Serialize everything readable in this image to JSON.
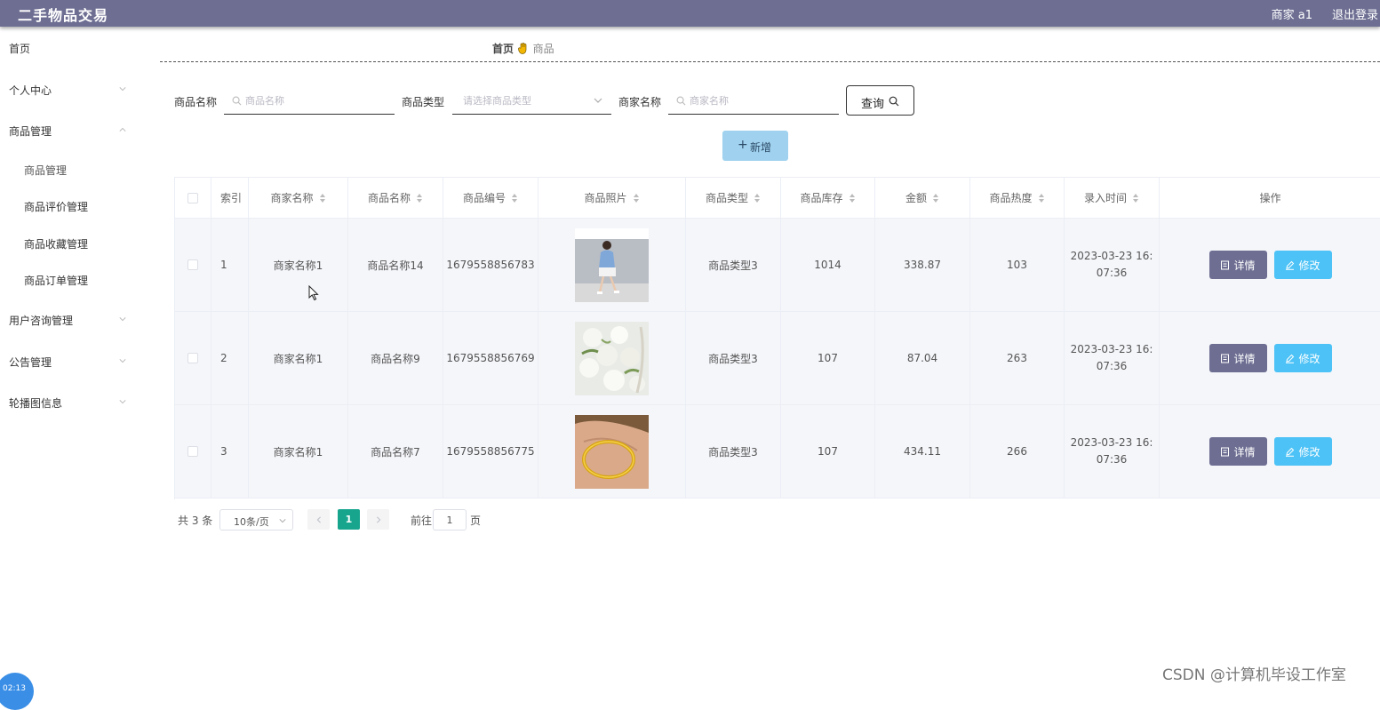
{
  "app": {
    "title": "二手物品交易",
    "user": "商家 a1",
    "logout": "退出登录"
  },
  "sidebar": {
    "home": "首页",
    "personal": "个人中心",
    "goods_group": "商品管理",
    "goods_sub": [
      "商品管理",
      "商品评价管理",
      "商品收藏管理",
      "商品订单管理"
    ],
    "consult": "用户咨询管理",
    "notice": "公告管理",
    "carousel": "轮播图信息"
  },
  "breadcrumb": {
    "home": "首页",
    "current": "商品"
  },
  "search": {
    "name_label": "商品名称",
    "name_placeholder": "商品名称",
    "type_label": "商品类型",
    "type_placeholder": "请选择商品类型",
    "merchant_label": "商家名称",
    "merchant_placeholder": "商家名称",
    "query_label": "查询"
  },
  "toolbar": {
    "add_label": "新增"
  },
  "table": {
    "headers": {
      "index": "索引",
      "merchant": "商家名称",
      "name": "商品名称",
      "code": "商品编号",
      "photo": "商品照片",
      "type": "商品类型",
      "stock": "商品库存",
      "price": "金额",
      "heat": "商品热度",
      "time": "录入时间",
      "ops": "操作"
    },
    "rows": [
      {
        "index": "1",
        "merchant": "商家名称1",
        "name": "商品名称14",
        "code": "1679558856783",
        "type": "商品类型3",
        "stock": "1014",
        "price": "338.87",
        "heat": "103",
        "time_date": "2023-03-23 16:",
        "time_clock": "07:36"
      },
      {
        "index": "2",
        "merchant": "商家名称1",
        "name": "商品名称9",
        "code": "1679558856769",
        "type": "商品类型3",
        "stock": "107",
        "price": "87.04",
        "heat": "263",
        "time_date": "2023-03-23 16:",
        "time_clock": "07:36"
      },
      {
        "index": "3",
        "merchant": "商家名称1",
        "name": "商品名称7",
        "code": "1679558856775",
        "type": "商品类型3",
        "stock": "107",
        "price": "434.11",
        "heat": "266",
        "time_date": "2023-03-23 16:",
        "time_clock": "07:36"
      }
    ],
    "detail_label": "详情",
    "edit_label": "修改"
  },
  "pagination": {
    "total": "共 3 条",
    "page_size": "10条/页",
    "current": "1",
    "goto": "前往",
    "goto_value": "1",
    "page_suffix": "页"
  },
  "watermark": "CSDN @计算机毕设工作室",
  "clock": "02:13",
  "colors": {
    "topbar": "#6d6e92",
    "accent_teal": "#17a58e",
    "edit_blue": "#4cc2f6",
    "add_blue": "#a0d2ef"
  }
}
